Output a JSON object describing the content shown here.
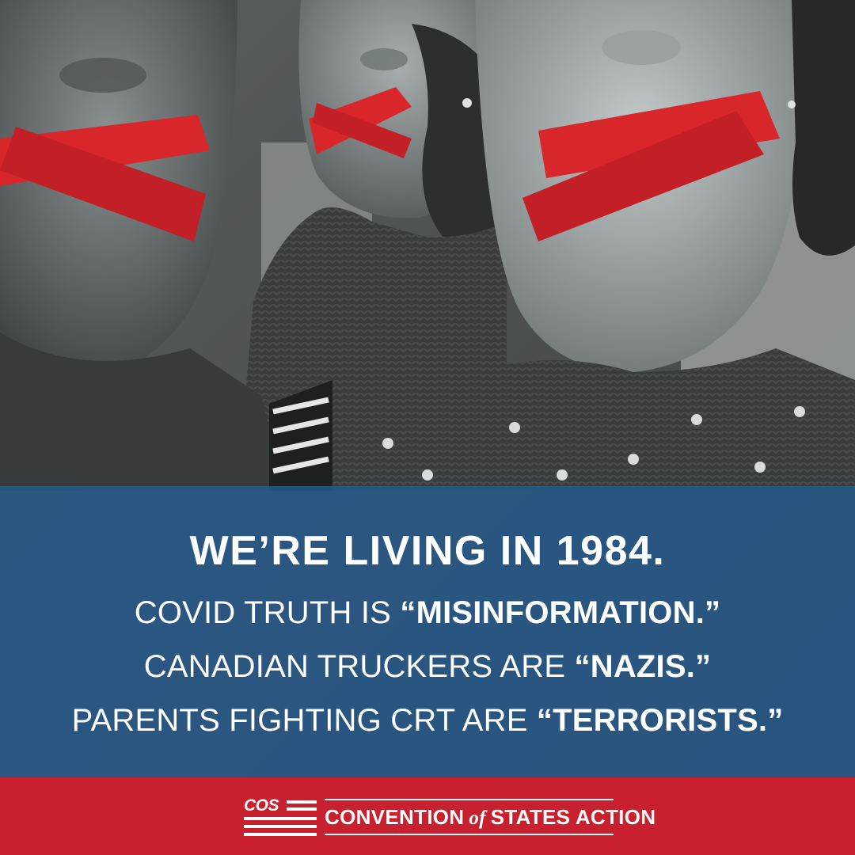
{
  "headline": "WE’RE LIVING IN 1984.",
  "lines": [
    {
      "prefix": "COVID TRUTH IS ",
      "emphasis": "“MISINFORMATION.”"
    },
    {
      "prefix": "CANADIAN TRUCKERS ARE ",
      "emphasis": "“NAZIS.”"
    },
    {
      "prefix": "PARENTS FIGHTING CRT ARE ",
      "emphasis": "“TERRORISTS.”"
    }
  ],
  "footer": {
    "logo_text": "COS",
    "org_part1": "CONVENTION",
    "org_of": "of",
    "org_part2": "STATES ACTION"
  },
  "colors": {
    "panel_blue": "#265888",
    "footer_red": "#c8202f",
    "tape_red": "#d8262b",
    "text": "#ffffff"
  }
}
